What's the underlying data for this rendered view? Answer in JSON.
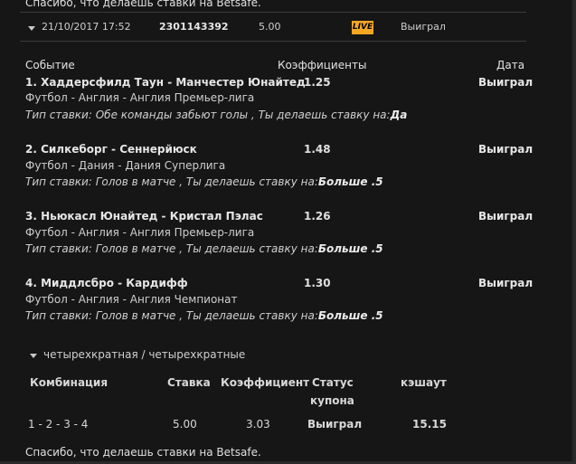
{
  "top_thanks": "Спасибо, что делаешь ставки на Betsafe.",
  "ticket": {
    "date": "21/10/2017 17:52",
    "id": "2301143392",
    "stake": "5.00",
    "live_badge": "LIVE",
    "status": "Выиграл"
  },
  "headers": {
    "event": "Событие",
    "odds": "Коэффициенты",
    "date": "Дата"
  },
  "bet_type_prefix": "Тип ставки:",
  "you_bet_on": "Ты делаешь ставку на:",
  "events": [
    {
      "title": "1. Хаддерсфилд Таун - Манчестер Юнайтед",
      "odds": "1.25",
      "result": "Выиграл",
      "sport": "Футбол - Англия - Англия Премьер-лига",
      "bet_type": "Обе команды забьют голы",
      "choice": "Да"
    },
    {
      "title": "2. Силкеборг - Сеннерйюск",
      "odds": "1.48",
      "result": "Выиграл",
      "sport": "Футбол - Дания - Дания Суперлига",
      "bet_type": "Голов в матче",
      "choice": "Больше .5"
    },
    {
      "title": "3. Ньюкасл Юнайтед - Кристал Пэлас",
      "odds": "1.26",
      "result": "Выиграл",
      "sport": "Футбол - Англия - Англия Премьер-лига",
      "bet_type": "Голов в матче",
      "choice": "Больше .5"
    },
    {
      "title": "4. Миддлсбро - Кардифф",
      "odds": "1.30",
      "result": "Выиграл",
      "sport": "Футбол - Англия - Англия Чемпионат",
      "bet_type": "Голов в матче",
      "choice": "Больше .5"
    }
  ],
  "combo": {
    "label": "четырехкратная / четырехкратные",
    "headers": {
      "combination": "Комбинация",
      "stake": "Ставка",
      "odds": "Коэффициент",
      "status_l1": "Статус",
      "status_l2": "купона",
      "cashout": "кэшаут"
    },
    "row": {
      "combination": "1 - 2 - 3 - 4",
      "stake": "5.00",
      "odds": "3.03",
      "status": "Выиграл",
      "cashout": "15.15"
    }
  },
  "bottom_thanks": "Спасибо, что делаешь ставки на Betsafe.",
  "colors": {
    "background": "#161616",
    "live_badge": "#f5a623",
    "divider": "#3a3a3a"
  }
}
